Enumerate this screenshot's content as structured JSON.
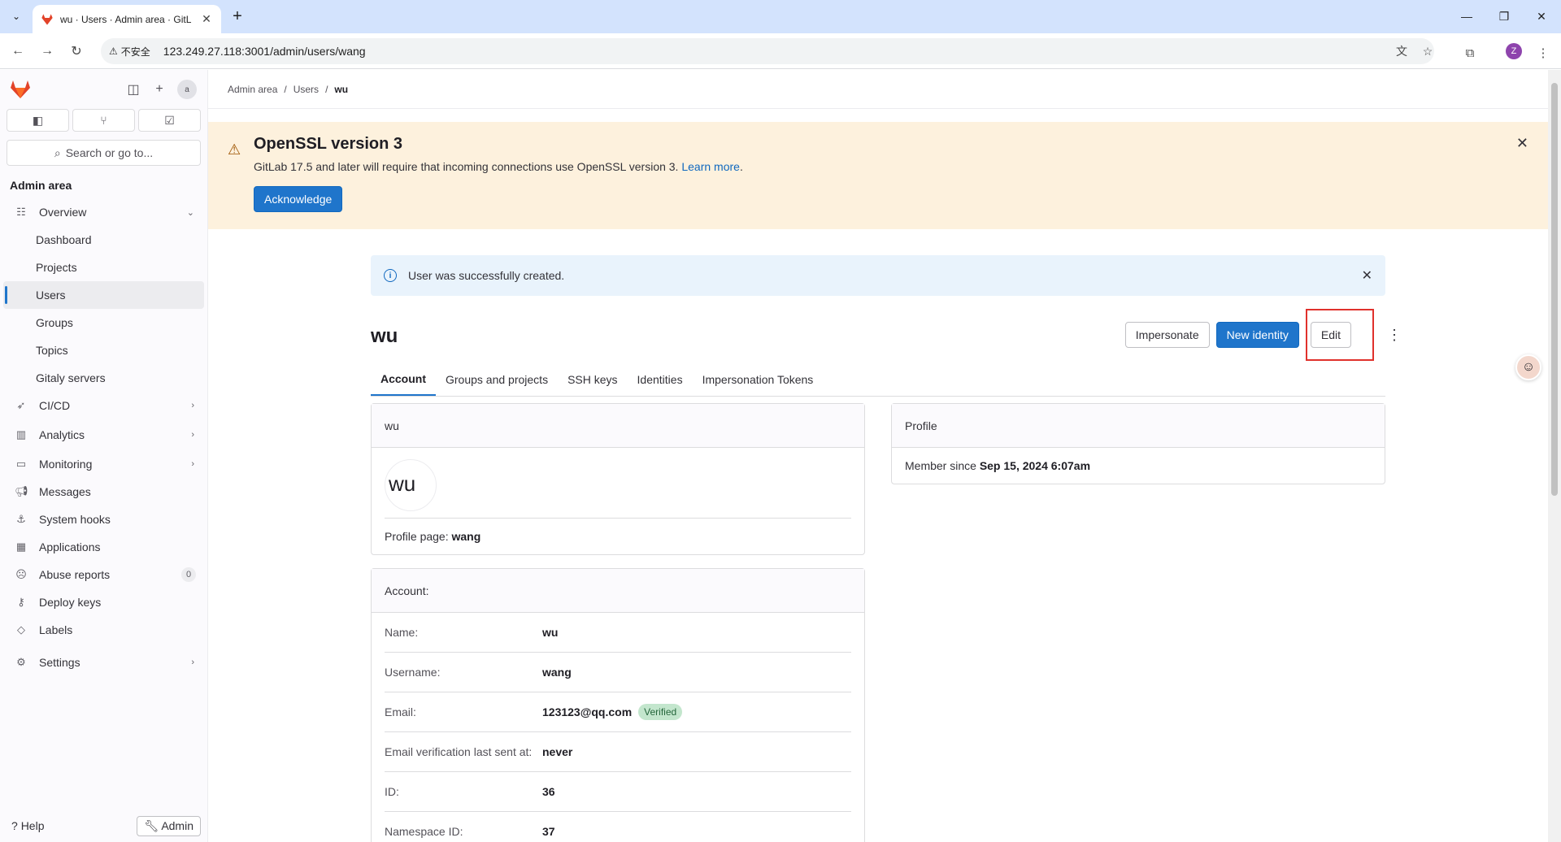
{
  "browser": {
    "tab_title": "wu · Users · Admin area · GitL",
    "security_label": "不安全",
    "url": "123.249.27.118:3001/admin/users/wang",
    "profile_initial": "Z"
  },
  "sidebar": {
    "section_title": "Admin area",
    "search_placeholder": "Search or go to...",
    "avatar_alt": "a",
    "overview": {
      "label": "Overview",
      "items": [
        "Dashboard",
        "Projects",
        "Users",
        "Groups",
        "Topics",
        "Gitaly servers"
      ],
      "active": "Users"
    },
    "items": [
      {
        "label": "CI/CD",
        "icon": "rocket-icon"
      },
      {
        "label": "Analytics",
        "icon": "chart-icon"
      },
      {
        "label": "Monitoring",
        "icon": "monitor-icon"
      },
      {
        "label": "Messages",
        "icon": "megaphone-icon"
      },
      {
        "label": "System hooks",
        "icon": "anchor-icon"
      },
      {
        "label": "Applications",
        "icon": "grid-icon"
      },
      {
        "label": "Abuse reports",
        "icon": "abuse-icon",
        "badge": "0"
      },
      {
        "label": "Deploy keys",
        "icon": "key-icon"
      },
      {
        "label": "Labels",
        "icon": "label-icon"
      }
    ],
    "settings": "Settings",
    "help": "Help",
    "admin": "Admin"
  },
  "breadcrumb": {
    "items": [
      "Admin area",
      "Users"
    ],
    "current": "wu"
  },
  "banner": {
    "title": "OpenSSL version 3",
    "text": "GitLab 17.5 and later will require that incoming connections use OpenSSL version 3.",
    "link": "Learn more",
    "period": ".",
    "button": "Acknowledge"
  },
  "alert": {
    "text": "User was successfully created."
  },
  "user": {
    "display_name": "wu",
    "actions": {
      "impersonate": "Impersonate",
      "new_identity": "New identity",
      "edit": "Edit"
    },
    "tabs": [
      "Account",
      "Groups and projects",
      "SSH keys",
      "Identities",
      "Impersonation Tokens"
    ],
    "active_tab": "Account",
    "card": {
      "header": "wu",
      "avatar_alt": "wu",
      "profile_page_label": "Profile page:",
      "profile_page_value": "wang"
    },
    "profile": {
      "header": "Profile",
      "member_since_label": "Member since",
      "member_since_value": "Sep 15, 2024 6:07am"
    },
    "account": {
      "header": "Account:",
      "rows": [
        {
          "label": "Name:",
          "value": "wu"
        },
        {
          "label": "Username:",
          "value": "wang"
        },
        {
          "label": "Email:",
          "value": "123123@qq.com",
          "badge": "Verified"
        },
        {
          "label": "Email verification last sent at:",
          "value": "never"
        },
        {
          "label": "ID:",
          "value": "36"
        },
        {
          "label": "Namespace ID:",
          "value": "37"
        }
      ]
    }
  },
  "colors": {
    "primary": "#1f75cb",
    "banner_bg": "#fdf1dd",
    "alert_bg": "#e9f3fc",
    "highlight": "#e0312c"
  }
}
